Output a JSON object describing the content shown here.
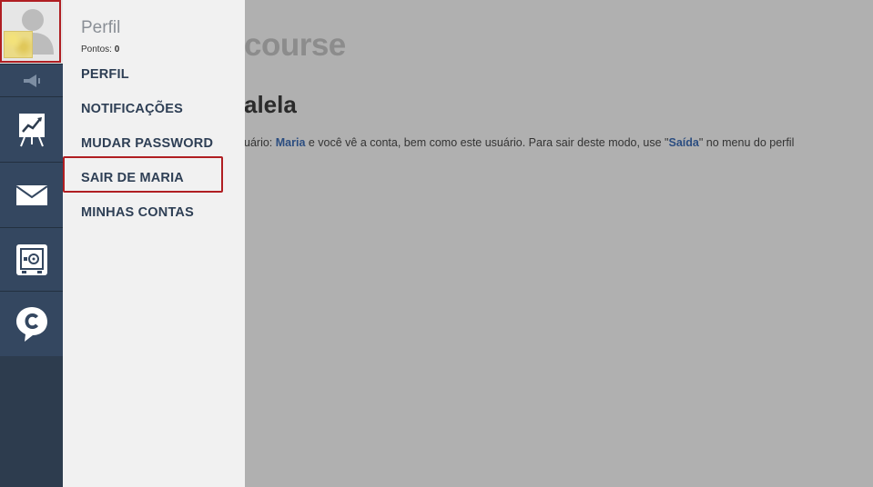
{
  "page": {
    "title_fragment": "course",
    "subtitle_fragment": "alela",
    "notice": {
      "prefix": "uário: ",
      "user": "Maria",
      "middle": " e você vê a conta, bem como este usuário. Para sair deste modo, use \"",
      "exit_word": "Saída",
      "suffix": "\" no menu do perfil"
    }
  },
  "profile_menu": {
    "title": "Perfil",
    "points_label": "Pontos:",
    "points_value": "0",
    "items": [
      {
        "label": "PERFIL"
      },
      {
        "label": "NOTIFICAÇÕES"
      },
      {
        "label": "MUDAR PASSWORD"
      },
      {
        "label": "SAIR DE MARIA"
      },
      {
        "label": "MINHAS CONTAS"
      }
    ]
  },
  "rail": {
    "icons": [
      "avatar",
      "megaphone-icon",
      "chart-easel-icon",
      "mail-icon",
      "safe-icon",
      "chat-c-icon"
    ]
  },
  "colors": {
    "rail": "#344760",
    "highlight": "#b01e22",
    "menu_text": "#2e3f55",
    "link": "#2b4d80"
  }
}
